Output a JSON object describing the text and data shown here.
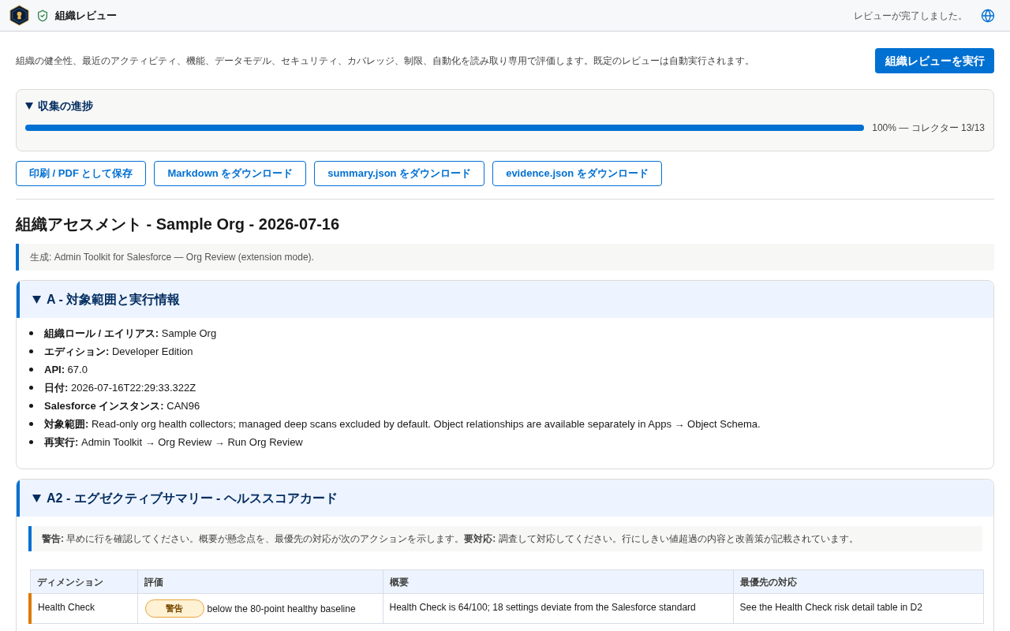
{
  "header": {
    "title": "組織レビュー",
    "status": "レビューが完了しました。"
  },
  "intro": {
    "description": "組織の健全性、最近のアクティビティ、機能、データモデル、セキュリティ、カバレッジ、制限、自動化を読み取り専用で評価します。既定のレビューは自動実行されます。",
    "run_button": "組織レビューを実行"
  },
  "progress": {
    "title": "収集の進捗",
    "expanded": true,
    "level": 1.0,
    "reading": "100% — コレクター 13/13"
  },
  "export_buttons": [
    "印刷 / PDF として保存",
    "Markdown をダウンロード",
    "summary.json をダウンロード",
    "evidence.json をダウンロード"
  ],
  "report": {
    "title": "組織アセスメント - Sample Org - 2026-07-16",
    "note": "生成: Admin Toolkit for Salesforce — Org Review (extension mode).",
    "sections": [
      {
        "kind": "list",
        "title": "A - 対象範囲と実行情報",
        "expanded": true,
        "items": [
          "**組織ロール / エイリアス:** Sample Org",
          "**エディション:** Developer Edition",
          "**API:** 67.0",
          "**日付:** 2026-07-16T22:29:33.322Z",
          "**Salesforce インスタンス:** CAN96",
          "**対象範囲:** Read-only org health collectors; managed deep scans excluded by default. Object relationships are available separately in Apps → Object Schema.",
          "**再実行:** Admin Toolkit → Org Review → Run Org Review"
        ]
      },
      {
        "kind": "table",
        "title": "A2 - エグゼクティブサマリー - ヘルススコアカード",
        "expanded": true,
        "callout": "**警告:** 早めに行を確認してください。概要が懸念点を、最優先の対応が次のアクションを示します。**要対応:** 調査して対応してください。行にしきい値超過の内容と改善策が記載されています。",
        "table": {
          "columns": [
            "ディメンション",
            "評価",
            "概要",
            "最優先の対応"
          ],
          "rows": [
            {
              "kind": "warning",
              "dimension": "Health Check",
              "badge": "警告",
              "rating": "below the 80-point healthy baseline",
              "summary": "Health Check is 64/100; 18 settings deviate from the Salesforce standard",
              "action": "See the Health Check risk detail table in D2"
            }
          ]
        }
      }
    ]
  }
}
